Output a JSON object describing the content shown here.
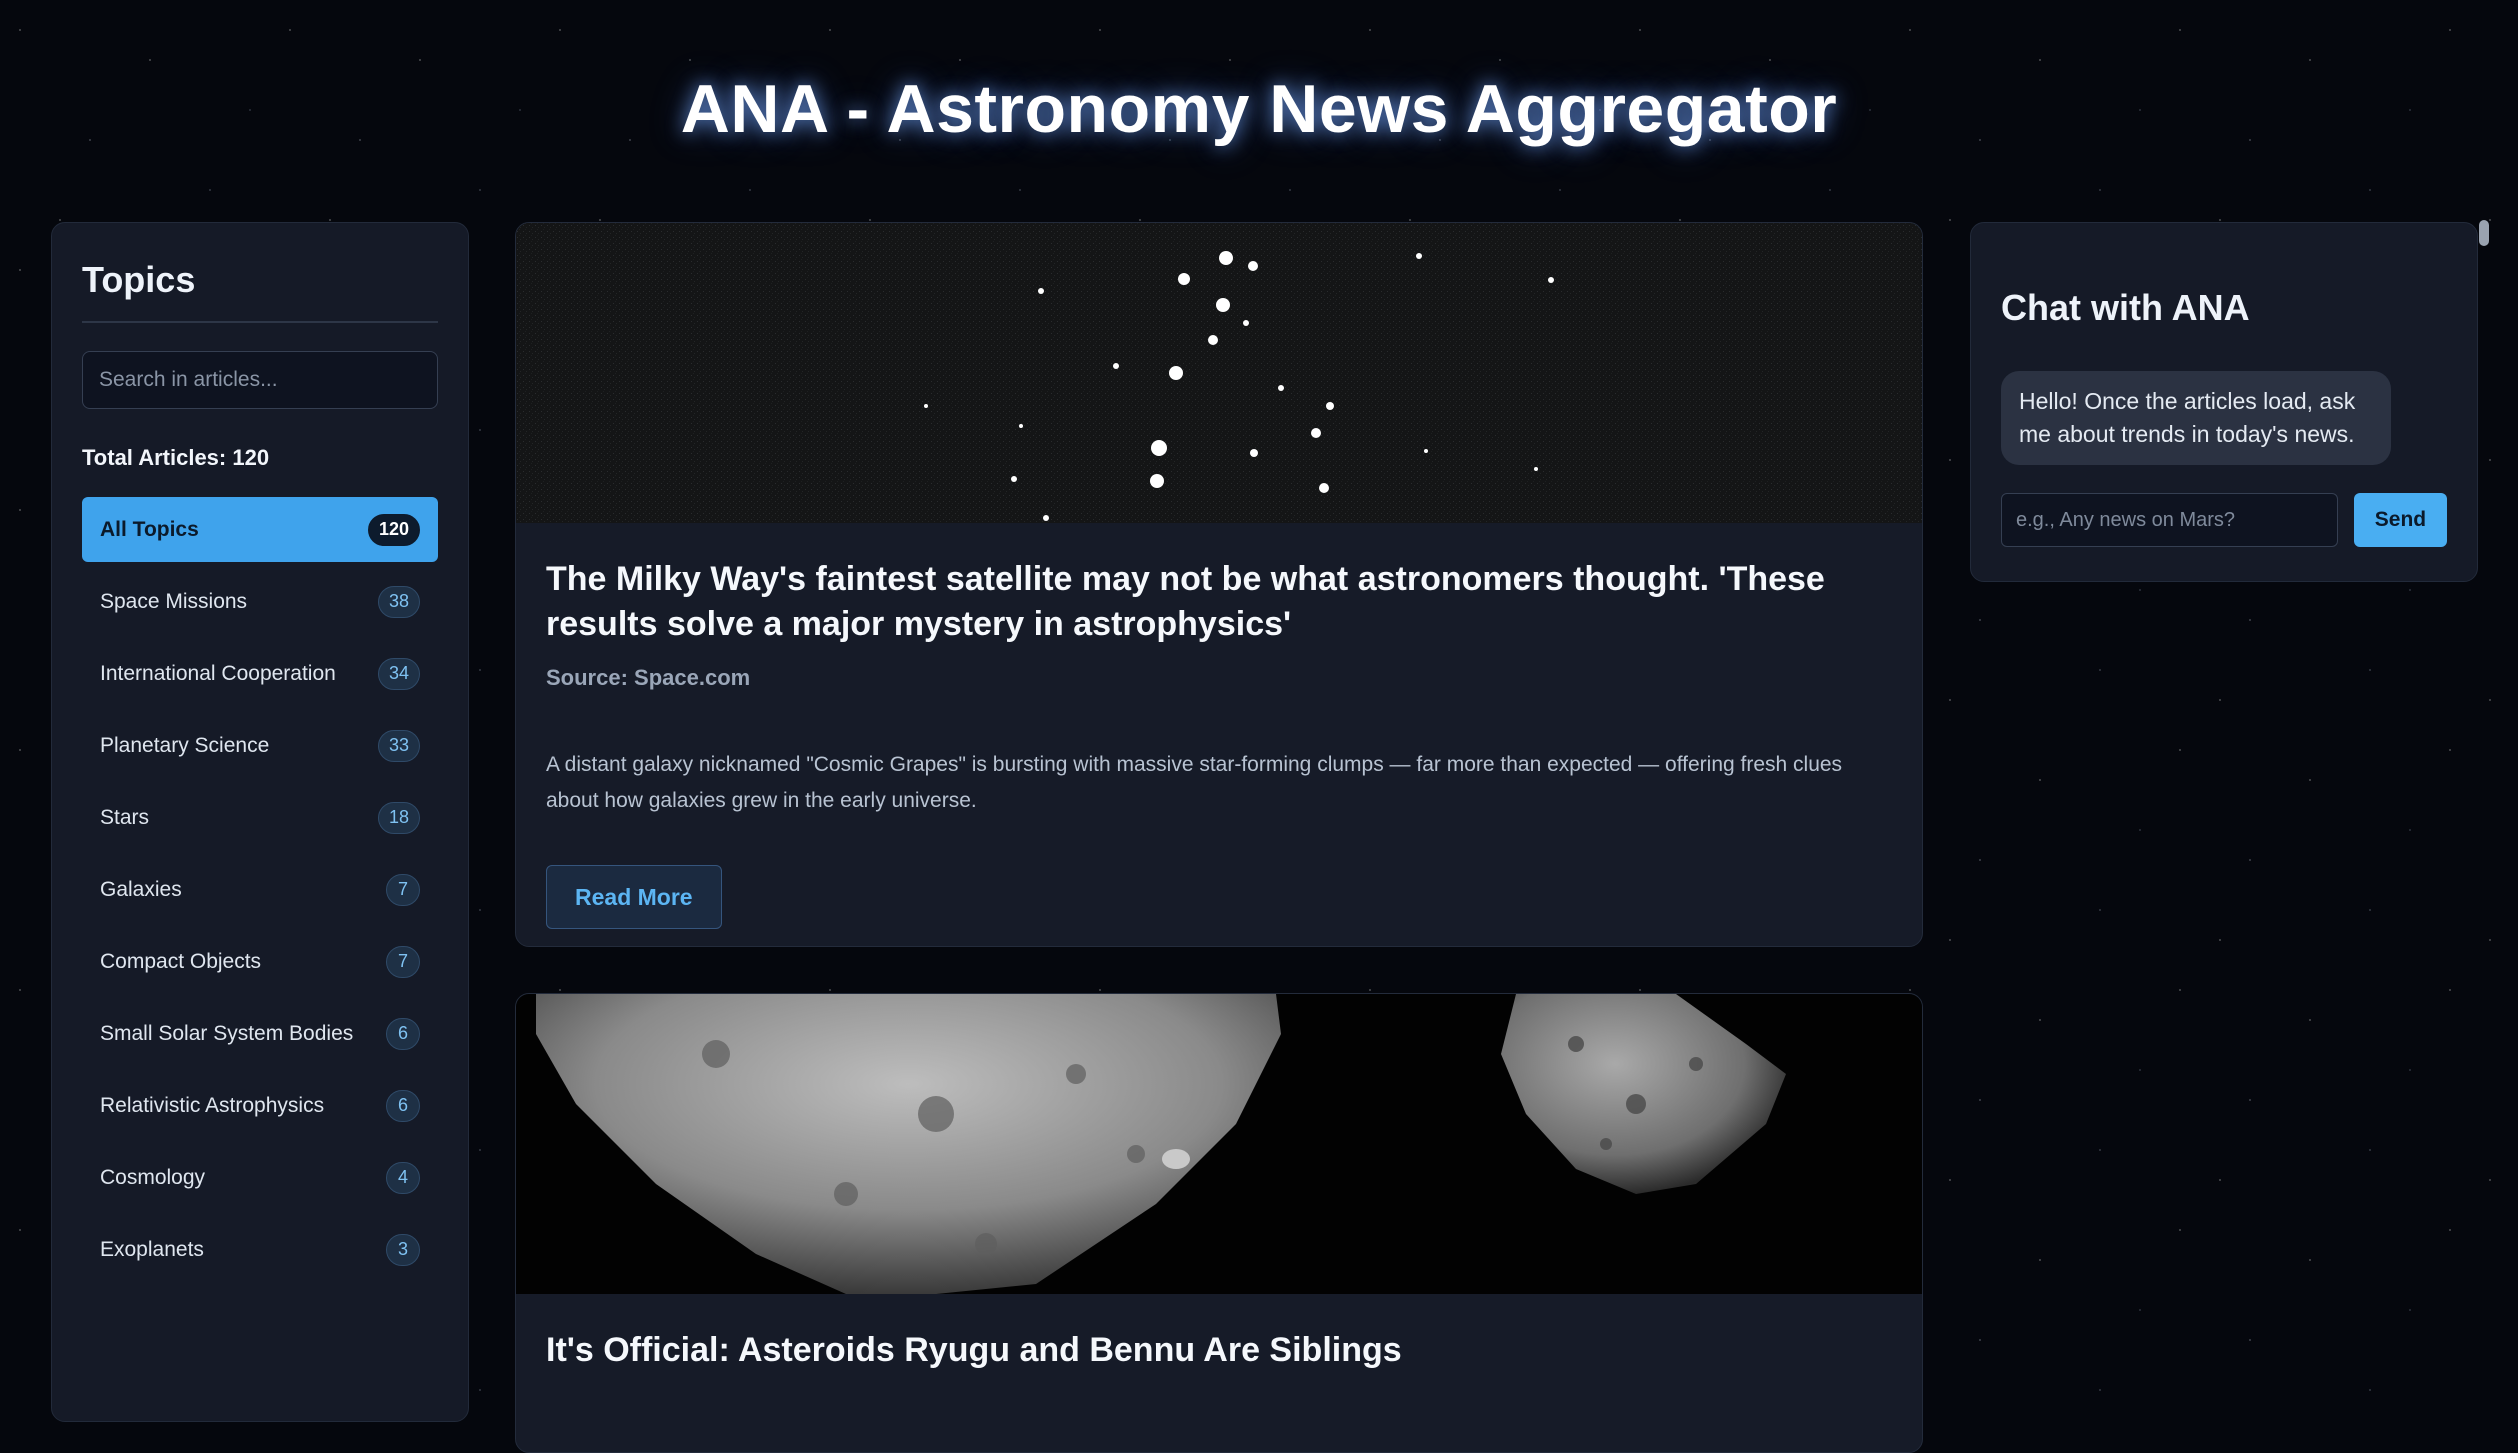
{
  "header": {
    "title": "ANA - Astronomy News Aggregator"
  },
  "sidebar": {
    "heading": "Topics",
    "search_placeholder": "Search in articles...",
    "total_label": "Total Articles: 120",
    "topics": [
      {
        "label": "All Topics",
        "count": "120",
        "active": true
      },
      {
        "label": "Space Missions",
        "count": "38"
      },
      {
        "label": "International Cooperation",
        "count": "34"
      },
      {
        "label": "Planetary Science",
        "count": "33"
      },
      {
        "label": "Stars",
        "count": "18"
      },
      {
        "label": "Galaxies",
        "count": "7"
      },
      {
        "label": "Compact Objects",
        "count": "7"
      },
      {
        "label": "Small Solar System Bodies",
        "count": "6"
      },
      {
        "label": "Relativistic Astrophysics",
        "count": "6"
      },
      {
        "label": "Cosmology",
        "count": "4"
      },
      {
        "label": "Exoplanets",
        "count": "3"
      }
    ]
  },
  "articles": [
    {
      "title": "The Milky Way's faintest satellite may not be what astronomers thought. 'These results solve a major mystery in astrophysics'",
      "source": "Source: Space.com",
      "description": "A distant galaxy nicknamed \"Cosmic Grapes\" is bursting with massive star-forming clumps — far more than expected — offering fresh clues about how galaxies grew in the early universe.",
      "read_more": "Read More"
    },
    {
      "title": "It's Official: Asteroids Ryugu and Bennu Are Siblings"
    }
  ],
  "chat": {
    "heading": "Chat with ANA",
    "greeting": "Hello! Once the articles load, ask me about trends in today's news.",
    "input_placeholder": "e.g., Any news on Mars?",
    "send_label": "Send"
  }
}
